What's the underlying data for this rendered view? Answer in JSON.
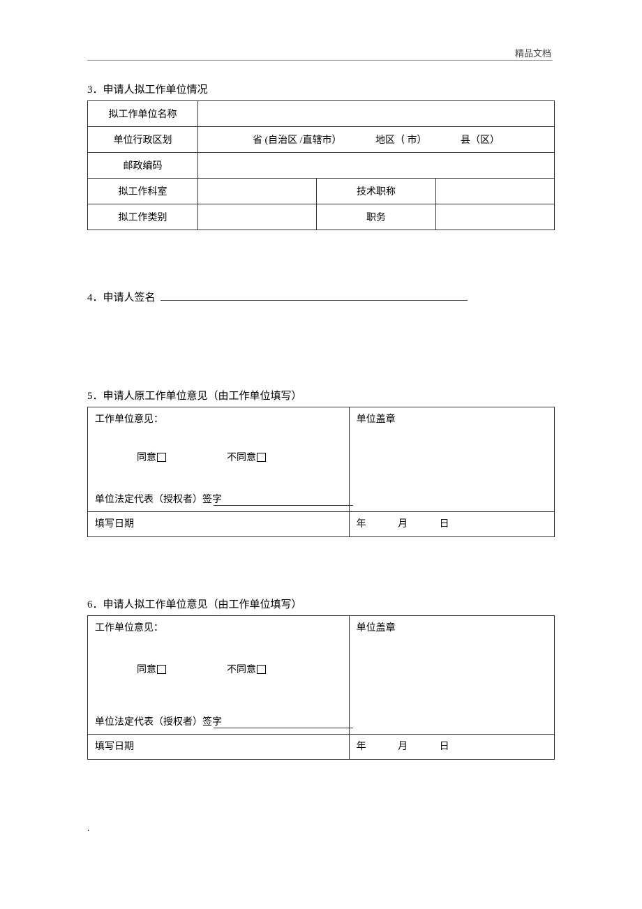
{
  "header": {
    "watermark": "精品文档"
  },
  "section3": {
    "heading_num": "3．",
    "heading_text": "申请人拟工作单位情况",
    "rows": {
      "unit_name_label": "拟工作单位名称",
      "unit_name_value": "",
      "admin_div_label": "单位行政区划",
      "admin_province": "省 (自治区 /直辖市）",
      "admin_region": "地区（ 市）",
      "admin_county": "县（区）",
      "postcode_label": "邮政编码",
      "postcode_value": "",
      "dept_label": "拟工作科室",
      "dept_value": "",
      "title_label": "技术职称",
      "title_value": "",
      "category_label": "拟工作类别",
      "category_value": "",
      "position_label": "职务",
      "position_value": ""
    }
  },
  "section4": {
    "heading_num": "4．",
    "heading_text": "申请人签名",
    "value": ""
  },
  "section5": {
    "heading_num": "5．",
    "heading_text": "申请人原工作单位意见（由工作单位填写）",
    "opinion_label": "工作单位意见：",
    "seal_label": "单位盖章",
    "agree_label": "同意",
    "disagree_label": "不同意",
    "rep_sig_label": "单位法定代表（授权者）签字",
    "date_label": "填写日期",
    "year": "年",
    "month": "月",
    "day": "日"
  },
  "section6": {
    "heading_num": "6．",
    "heading_text": "申请人拟工作单位意见（由工作单位填写）",
    "opinion_label": "工作单位意见：",
    "seal_label": "单位盖章",
    "agree_label": "同意",
    "disagree_label": "不同意",
    "rep_sig_label": "单位法定代表（授权者）签字",
    "date_label": "填写日期",
    "year": "年",
    "month": "月",
    "day": "日"
  },
  "footer": {
    "dot": "."
  }
}
